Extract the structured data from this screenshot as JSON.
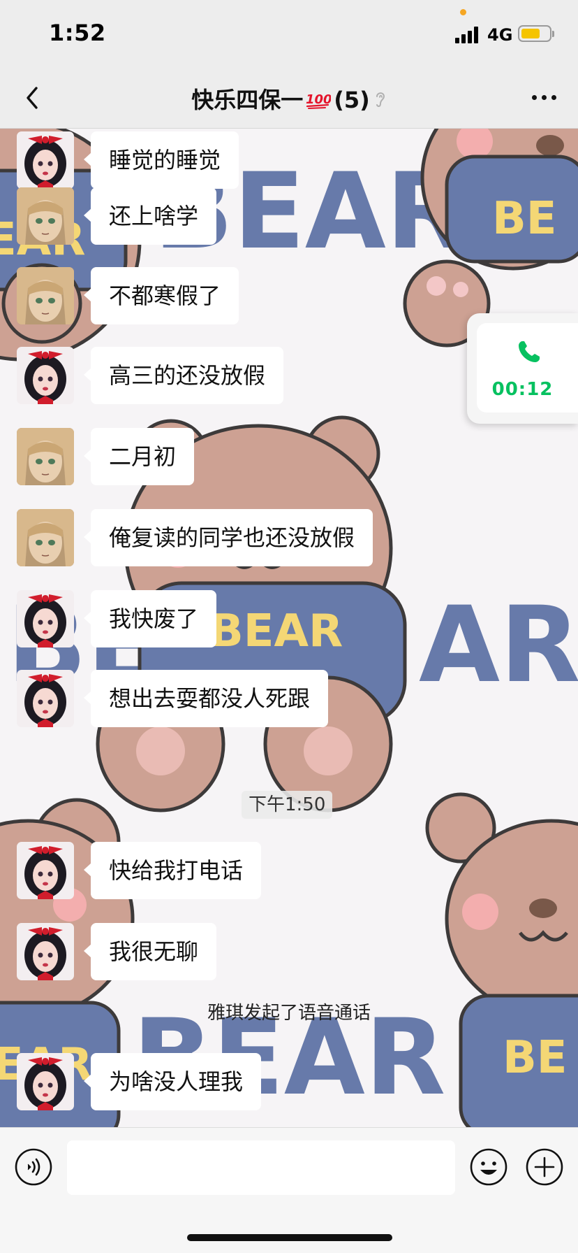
{
  "status_bar": {
    "time": "1:52",
    "network": "4G"
  },
  "header": {
    "title": "快乐四保一",
    "member_count": "(5)",
    "title_emoji": "hundred-points-icon"
  },
  "messages": [
    {
      "avatar": "snow-white",
      "text": "睡觉的睡觉"
    },
    {
      "avatar": "blonde-girl",
      "text": "还上啥学"
    },
    {
      "avatar": "blonde-girl",
      "text": "不都寒假了"
    },
    {
      "avatar": "snow-white",
      "text": "高三的还没放假"
    },
    {
      "avatar": "blonde-girl",
      "text": "二月初"
    },
    {
      "avatar": "blonde-girl",
      "text": "俺复读的同学也还没放假"
    },
    {
      "avatar": "snow-white",
      "text": "我快废了"
    },
    {
      "avatar": "snow-white",
      "text": "想出去耍都没人死跟"
    },
    {
      "avatar": "snow-white",
      "text": "快给我打电话"
    },
    {
      "avatar": "snow-white",
      "text": "我很无聊"
    },
    {
      "avatar": "snow-white",
      "text": "为啥没人理我"
    }
  ],
  "time_divider": "下午1:50",
  "system_notice": "雅琪发起了语音通话",
  "call_widget": {
    "duration": "00:12",
    "accent_color": "#07c160"
  },
  "input_bar": {
    "value": "",
    "placeholder": ""
  },
  "colors": {
    "bubble": "#ffffff",
    "background": "#ededed"
  }
}
